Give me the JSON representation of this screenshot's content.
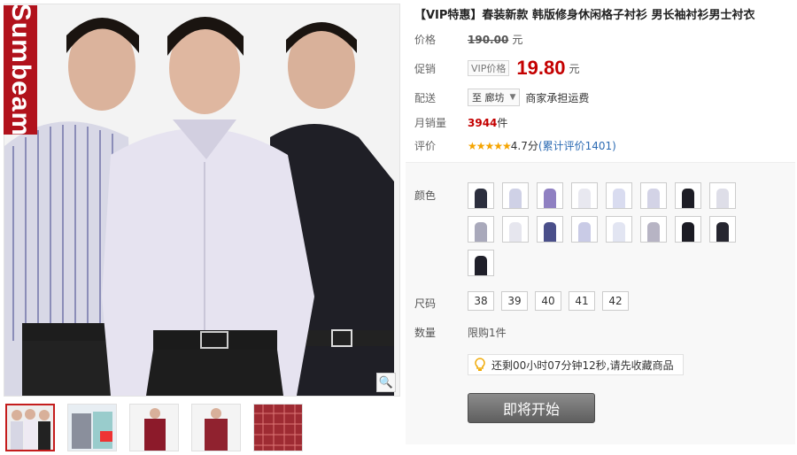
{
  "brand": {
    "badge_text": "Sumbeam"
  },
  "gallery": {
    "zoom_icon": "magnifier-icon",
    "thumbnails": [
      "model-trio-white-purple-black",
      "plaid-shirts-collage",
      "red-plaid-shirt-model-1",
      "red-plaid-shirt-model-2",
      "red-plaid-shirt-closeup"
    ],
    "selected_index": 0
  },
  "product": {
    "title": "【VIP特惠】春装新款 韩版修身休闲格子衬衫 男长袖衬衫男士衬衣",
    "price_label": "价格",
    "original_price": "190.00",
    "currency_unit": "元",
    "promo_label": "促销",
    "vip_tag": "VIP价格",
    "sale_price": "19.80",
    "shipping_label": "配送",
    "shipping_destination": "至 廊坊",
    "shipping_note": "商家承担运费",
    "monthly_sales_label": "月销量",
    "monthly_sales": "3944",
    "sales_unit": "件",
    "rating_label": "评价",
    "rating_stars": "★★★★★",
    "rating_score": "4.7分",
    "rating_link": "(累计评价1401)"
  },
  "sku": {
    "color_label": "颜色",
    "colors": [
      "#2c2f3e",
      "#cfd1e6",
      "#8f80c2",
      "#e8e8f0",
      "#d9dcf0",
      "#d3d3e6",
      "#1e1e26",
      "#dedee8",
      "#a9a9bb",
      "#e6e6ee",
      "#4a4f8a",
      "#c9cbe6",
      "#e2e5f2",
      "#b7b4c4",
      "#1c1c24",
      "#262630",
      "#20202a"
    ],
    "size_label": "尺码",
    "sizes": [
      "38",
      "39",
      "40",
      "41",
      "42"
    ],
    "quantity_label": "数量",
    "quantity_limit": "限购1件",
    "notice_icon": "lightbulb-icon",
    "countdown_notice": "还剩00小时07分钟12秒,请先收藏商品",
    "cta_label": "即将开始"
  }
}
